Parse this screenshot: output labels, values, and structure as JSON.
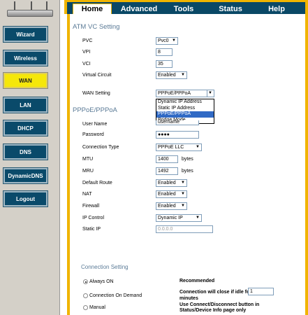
{
  "sidebar": {
    "items": [
      {
        "label": "Wizard",
        "active": false
      },
      {
        "label": "Wireless",
        "active": false
      },
      {
        "label": "WAN",
        "active": true
      },
      {
        "label": "LAN",
        "active": false
      },
      {
        "label": "DHCP",
        "active": false
      },
      {
        "label": "DNS",
        "active": false
      },
      {
        "label": "DynamicDNS",
        "active": false
      },
      {
        "label": "Logout",
        "active": false
      }
    ]
  },
  "tabs": [
    {
      "label": "Home",
      "active": true
    },
    {
      "label": "Advanced",
      "active": false
    },
    {
      "label": "Tools",
      "active": false
    },
    {
      "label": "Status",
      "active": false
    },
    {
      "label": "Help",
      "active": false
    }
  ],
  "atm": {
    "title": "ATM VC Setting",
    "pvc_label": "PVC",
    "pvc_value": "Pvc0",
    "vpi_label": "VPI",
    "vpi_value": "8",
    "vci_label": "VCI",
    "vci_value": "35",
    "vc_label": "Virtual Circuit",
    "vc_value": "Enabled",
    "wan_label": "WAN Setting",
    "wan_value": "PPPoE/PPPoA",
    "wan_options": [
      "Dynamic IP Address",
      "Static IP Address",
      "PPPoE/PPPoA",
      "Bridge Mode"
    ]
  },
  "pppoe": {
    "title": "PPPoE/PPPoA",
    "user_label": "User Name",
    "user_value": "username",
    "pass_label": "Password",
    "pass_value": "●●●●",
    "conn_type_label": "Connection Type",
    "conn_type_value": "PPPoE LLC",
    "mtu_label": "MTU",
    "mtu_value": "1400",
    "mtu_unit": "bytes",
    "mru_label": "MRU",
    "mru_value": "1492",
    "mru_unit": "bytes",
    "route_label": "Default Route",
    "route_value": "Enabled",
    "nat_label": "NAT",
    "nat_value": "Enabled",
    "firewall_label": "Firewall",
    "firewall_value": "Enabled",
    "ipcontrol_label": "IP Control",
    "ipcontrol_value": "Dynamic IP",
    "staticip_label": "Static IP",
    "staticip_placeholder": "0.0.0.0"
  },
  "connection": {
    "title": "Connection Setting",
    "always_on": "Always ON",
    "always_on_desc": "Recommended",
    "on_demand": "Connection On Demand",
    "on_demand_desc": "Connection will close if idle for",
    "on_demand_unit": "minutes",
    "on_demand_value": "1",
    "manual": "Manual",
    "manual_desc": "Use Connect/Disconnect button in Status/Device Info page only"
  }
}
